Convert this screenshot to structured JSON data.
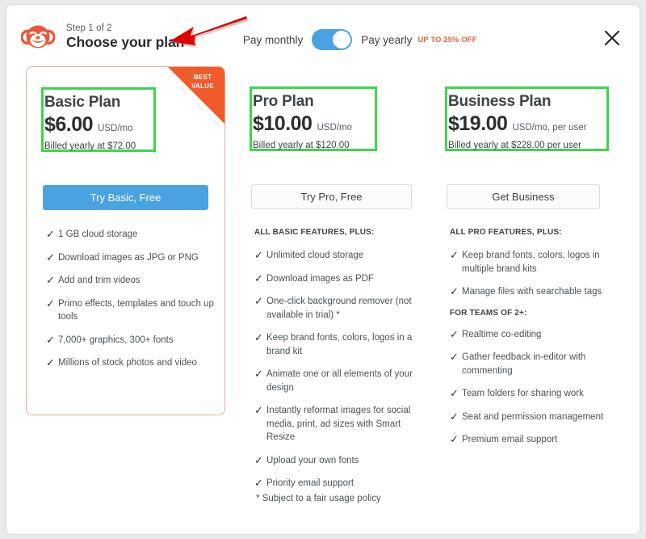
{
  "header": {
    "logo_icon": "monkey-logo-icon",
    "step": "Step 1 of 2",
    "title": "Choose your plan",
    "close_icon": "close-icon",
    "billing": {
      "monthly_label": "Pay monthly",
      "yearly_label": "Pay yearly",
      "promo": "UP TO 25% OFF",
      "toggle_state": "yearly",
      "toggle_on_color": "#4aa3e0"
    }
  },
  "annotations": {
    "arrow_color": "#d8000c",
    "highlight_color": "#3fd44a",
    "arrow_target": "Choose your plan"
  },
  "plans": [
    {
      "id": "basic",
      "name": "Basic Plan",
      "price": "$6.00",
      "unit": "USD/mo",
      "billed": "Billed yearly at $72.00",
      "ribbon": "BEST VALUE",
      "ribbon_line1": "BEST",
      "ribbon_line2": "VALUE",
      "cta": "Try Basic, Free",
      "cta_style": "primary",
      "highlighted": true,
      "card_border_color": "#efa98b",
      "feature_heading": "",
      "features": [
        "1 GB cloud storage",
        "Download images as JPG or PNG",
        "Add and trim videos",
        "Primo effects, templates and touch up tools",
        "7,000+ graphics, 300+ fonts",
        "Millions of stock photos and video"
      ],
      "feature_groups": [],
      "footnote": ""
    },
    {
      "id": "pro",
      "name": "Pro Plan",
      "price": "$10.00",
      "unit": "USD/mo",
      "billed": "Billed yearly at $120.00",
      "ribbon": "",
      "cta": "Try Pro, Free",
      "cta_style": "secondary",
      "highlighted": false,
      "feature_heading": "ALL BASIC FEATURES, PLUS:",
      "features": [
        "Unlimited cloud storage",
        "Download images as PDF",
        "One-click background remover (not available in trial) *",
        "Keep brand fonts, colors, logos in a brand kit",
        "Animate one or all elements of your design",
        "Instantly reformat images for social media, print, ad sizes with Smart Resize",
        "Upload your own fonts",
        "Priority email support"
      ],
      "feature_groups": [],
      "footnote": "* Subject to a fair usage policy"
    },
    {
      "id": "business",
      "name": "Business Plan",
      "price": "$19.00",
      "unit": "USD/mo, per user",
      "billed": "Billed yearly at $228.00 per user",
      "ribbon": "",
      "cta": "Get Business",
      "cta_style": "secondary",
      "highlighted": false,
      "feature_heading": "ALL PRO FEATURES, PLUS:",
      "features": [
        "Keep brand fonts, colors, logos in multiple brand kits",
        "Manage files with searchable tags"
      ],
      "feature_groups": [
        {
          "heading": "FOR TEAMS OF 2+:",
          "items": [
            "Realtime co-editing",
            "Gather feedback in-editor with commenting",
            "Team folders for sharing work",
            "Seat and permission management",
            "Premium email support"
          ]
        }
      ],
      "footnote": ""
    }
  ]
}
